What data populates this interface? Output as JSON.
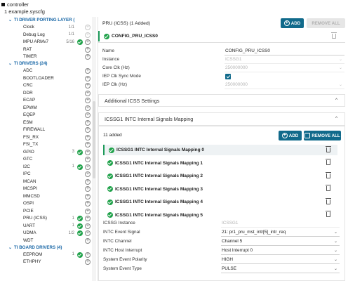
{
  "header": {
    "app_name": "controller",
    "file_name": "1 example.syscfg"
  },
  "sidebar": {
    "sections": [
      {
        "label": "TI DRIVER PORTING LAYER (",
        "items": [
          {
            "label": "Clock",
            "count": "1/1",
            "ok": false,
            "faint": true
          },
          {
            "label": "Debug Log",
            "count": "1/1",
            "ok": false,
            "faint": true
          },
          {
            "label": "MPU ARMv7",
            "count": "5/16",
            "ok": true,
            "faint": false
          },
          {
            "label": "RAT",
            "count": "",
            "ok": false,
            "faint": false
          },
          {
            "label": "TIMER",
            "count": "",
            "ok": false,
            "faint": false
          }
        ]
      },
      {
        "label": "TI DRIVERS (24)",
        "items": [
          {
            "label": "ADC",
            "count": "",
            "ok": false,
            "faint": false
          },
          {
            "label": "BOOTLOADER",
            "count": "",
            "ok": false,
            "faint": false
          },
          {
            "label": "CRC",
            "count": "",
            "ok": false,
            "faint": false
          },
          {
            "label": "DDR",
            "count": "",
            "ok": false,
            "faint": false
          },
          {
            "label": "ECAP",
            "count": "",
            "ok": false,
            "faint": false
          },
          {
            "label": "EPWM",
            "count": "",
            "ok": false,
            "faint": false
          },
          {
            "label": "EQEP",
            "count": "",
            "ok": false,
            "faint": false
          },
          {
            "label": "ESM",
            "count": "",
            "ok": false,
            "faint": false
          },
          {
            "label": "FIREWALL",
            "count": "",
            "ok": false,
            "faint": false
          },
          {
            "label": "FSI_RX",
            "count": "",
            "ok": false,
            "faint": false
          },
          {
            "label": "FSI_TX",
            "count": "",
            "ok": false,
            "faint": false
          },
          {
            "label": "GPIO",
            "count": "3",
            "ok": true,
            "faint": false
          },
          {
            "label": "GTC",
            "count": "",
            "ok": false,
            "faint": false
          },
          {
            "label": "I2C",
            "count": "1",
            "ok": true,
            "faint": false
          },
          {
            "label": "IPC",
            "count": "",
            "ok": false,
            "faint": false
          },
          {
            "label": "MCAN",
            "count": "",
            "ok": false,
            "faint": false
          },
          {
            "label": "MCSPI",
            "count": "",
            "ok": false,
            "faint": false
          },
          {
            "label": "MMCSD",
            "count": "",
            "ok": false,
            "faint": false
          },
          {
            "label": "OSPI",
            "count": "",
            "ok": false,
            "faint": false
          },
          {
            "label": "PCIE",
            "count": "",
            "ok": false,
            "faint": false
          },
          {
            "label": "PRU (ICSS)",
            "count": "1",
            "ok": true,
            "faint": false
          },
          {
            "label": "UART",
            "count": "1",
            "ok": true,
            "faint": false
          },
          {
            "label": "UDMA",
            "count": "1/2",
            "ok": true,
            "faint": false
          },
          {
            "label": "WDT",
            "count": "",
            "ok": false,
            "faint": false
          }
        ]
      },
      {
        "label": "TI BOARD DRIVERS (4)",
        "items": [
          {
            "label": "EEPROM",
            "count": "1",
            "ok": true,
            "faint": false
          },
          {
            "label": "ETHPHY",
            "count": "",
            "ok": false,
            "faint": false
          }
        ]
      }
    ]
  },
  "main": {
    "module_title": "PRU (ICSS) (1 Added)",
    "add_label": "ADD",
    "remove_all_label": "REMOVE ALL",
    "config_name": "CONFIG_PRU_ICSS0",
    "properties": [
      {
        "label": "Name",
        "value": "CONFIG_PRU_ICSS0",
        "readonly": false,
        "dropdown": false,
        "checkbox": false
      },
      {
        "label": "Instance",
        "value": "ICSSG1",
        "readonly": true,
        "dropdown": true,
        "checkbox": false
      },
      {
        "label": "Core Clk (Hz)",
        "value": "250000000",
        "readonly": true,
        "dropdown": true,
        "checkbox": false
      },
      {
        "label": "IEP Clk Sync Mode",
        "value": "",
        "readonly": false,
        "dropdown": false,
        "checkbox": true
      },
      {
        "label": "IEP Clk (Hz)",
        "value": "250000000",
        "readonly": true,
        "dropdown": true,
        "checkbox": false
      }
    ],
    "additional_settings": "Additional ICSS Settings",
    "intc_header": "ICSSG1 INTC Internal Signals Mapping",
    "added_count": "11 added",
    "sub_add_label": "ADD",
    "sub_remove_all_label": "REMOVE ALL",
    "mappings": [
      "ICSSG1 INTC Internal Signals Mapping 0",
      "ICSSG1 INTC Internal Signals Mapping 1",
      "ICSSG1 INTC Internal Signals Mapping 2",
      "ICSSG1 INTC Internal Signals Mapping 3",
      "ICSSG1 INTC Internal Signals Mapping 4",
      "ICSSG1 INTC Internal Signals Mapping 5"
    ],
    "details": [
      {
        "label": "ICSSG Instance",
        "value": "ICSSG1",
        "readonly": true,
        "dropdown": false
      },
      {
        "label": "INTC Event Signal",
        "value": "21: pr1_pru_mst_intr[5]_intr_req",
        "readonly": false,
        "dropdown": true
      },
      {
        "label": "INTC Channel",
        "value": "Channel 5",
        "readonly": false,
        "dropdown": true
      },
      {
        "label": "INTC Host Interrupt",
        "value": "Host Interrupt 0",
        "readonly": false,
        "dropdown": true
      },
      {
        "label": "System Event Polarity",
        "value": "HIGH",
        "readonly": false,
        "dropdown": true
      },
      {
        "label": "System Event Type",
        "value": "PULSE",
        "readonly": false,
        "dropdown": true
      }
    ]
  }
}
